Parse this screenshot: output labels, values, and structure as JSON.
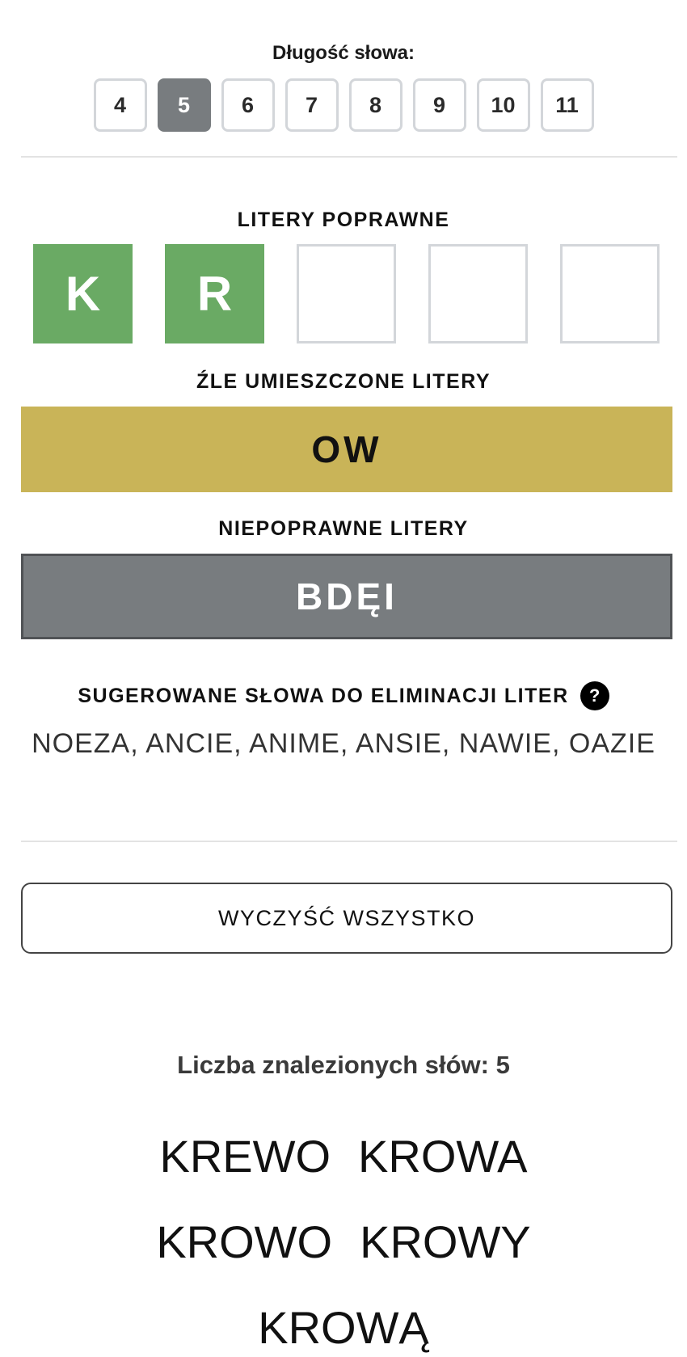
{
  "length_selector": {
    "label": "Długość słowa:",
    "options": [
      "4",
      "5",
      "6",
      "7",
      "8",
      "9",
      "10",
      "11"
    ],
    "selected": "5"
  },
  "correct": {
    "label": "LITERY POPRAWNE",
    "tiles": [
      "K",
      "R",
      "",
      "",
      ""
    ]
  },
  "misplaced": {
    "label": "ŹLE UMIESZCZONE LITERY",
    "value": "OW",
    "color": "#c9b458"
  },
  "incorrect": {
    "label": "NIEPOPRAWNE LITERY",
    "value": "BDĘI",
    "color": "#787c7f"
  },
  "suggestions": {
    "label": "SUGEROWANE SŁOWA DO ELIMINACJI LITER",
    "help_symbol": "?",
    "words": "NOEZA, ANCIE, ANIME, ANSIE, NAWIE, OAZIE"
  },
  "clear_button": {
    "label": "WYCZYŚĆ WSZYSTKO"
  },
  "results": {
    "count_label": "Liczba znalezionych słów: 5",
    "words": [
      "KREWO",
      "KROWA",
      "KROWO",
      "KROWY",
      "KROWĄ"
    ]
  },
  "colors": {
    "correct": "#6aaa64",
    "selected_length": "#787c7f"
  }
}
